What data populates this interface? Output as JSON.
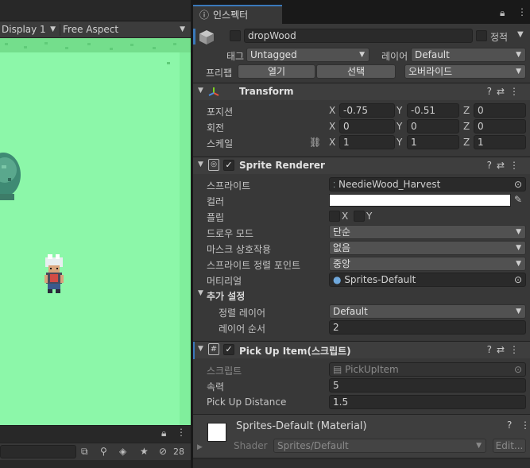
{
  "game_view": {
    "display": "Display 1",
    "aspect": "Free Aspect",
    "stats_count": "28"
  },
  "inspector": {
    "tab_label": "인스펙터",
    "object": {
      "name": "dropWood",
      "static_label": "정적",
      "tag_label": "태그",
      "tag_value": "Untagged",
      "layer_label": "레이어",
      "layer_value": "Default",
      "prefab_label": "프리팹",
      "open_button": "열기",
      "select_button": "선택",
      "overrides_button": "오버라이드"
    },
    "transform": {
      "title": "Transform",
      "position_label": "포지션",
      "rotation_label": "회전",
      "scale_label": "스케일",
      "position": {
        "x": "-0.75",
        "y": "-0.51",
        "z": "0"
      },
      "rotation": {
        "x": "0",
        "y": "0",
        "z": "0"
      },
      "scale": {
        "x": "1",
        "y": "1",
        "z": "1"
      },
      "axis_x": "X",
      "axis_y": "Y",
      "axis_z": "Z"
    },
    "sprite_renderer": {
      "title": "Sprite Renderer",
      "sprite_label": "스프라이트",
      "sprite_value": "NeedieWood_Harvest",
      "color_label": "컬러",
      "flip_label": "플립",
      "flip_x": "X",
      "flip_y": "Y",
      "draw_mode_label": "드로우 모드",
      "draw_mode_value": "단순",
      "mask_label": "마스크 상호작용",
      "mask_value": "없음",
      "pivot_label": "스프라이트 정렬 포인트",
      "pivot_value": "중앙",
      "material_label": "머티리얼",
      "material_value": "Sprites-Default",
      "additional_label": "추가 설정",
      "sorting_layer_label": "정렬 레이어",
      "sorting_layer_value": "Default",
      "order_label": "레이어 순서",
      "order_value": "2"
    },
    "pickup": {
      "title": "Pick Up Item(스크립트)",
      "script_label": "스크립트",
      "script_value": "PickUpItem",
      "speed_label": "속력",
      "speed_value": "5",
      "distance_label": "Pick Up Distance",
      "distance_value": "1.5"
    },
    "material": {
      "title": "Sprites-Default (Material)",
      "shader_label": "Shader",
      "shader_value": "Sprites/Default",
      "edit_button": "Edit..."
    }
  },
  "colors": {
    "game_bg": "#8cf7a9",
    "accent": "#3a79bb"
  }
}
